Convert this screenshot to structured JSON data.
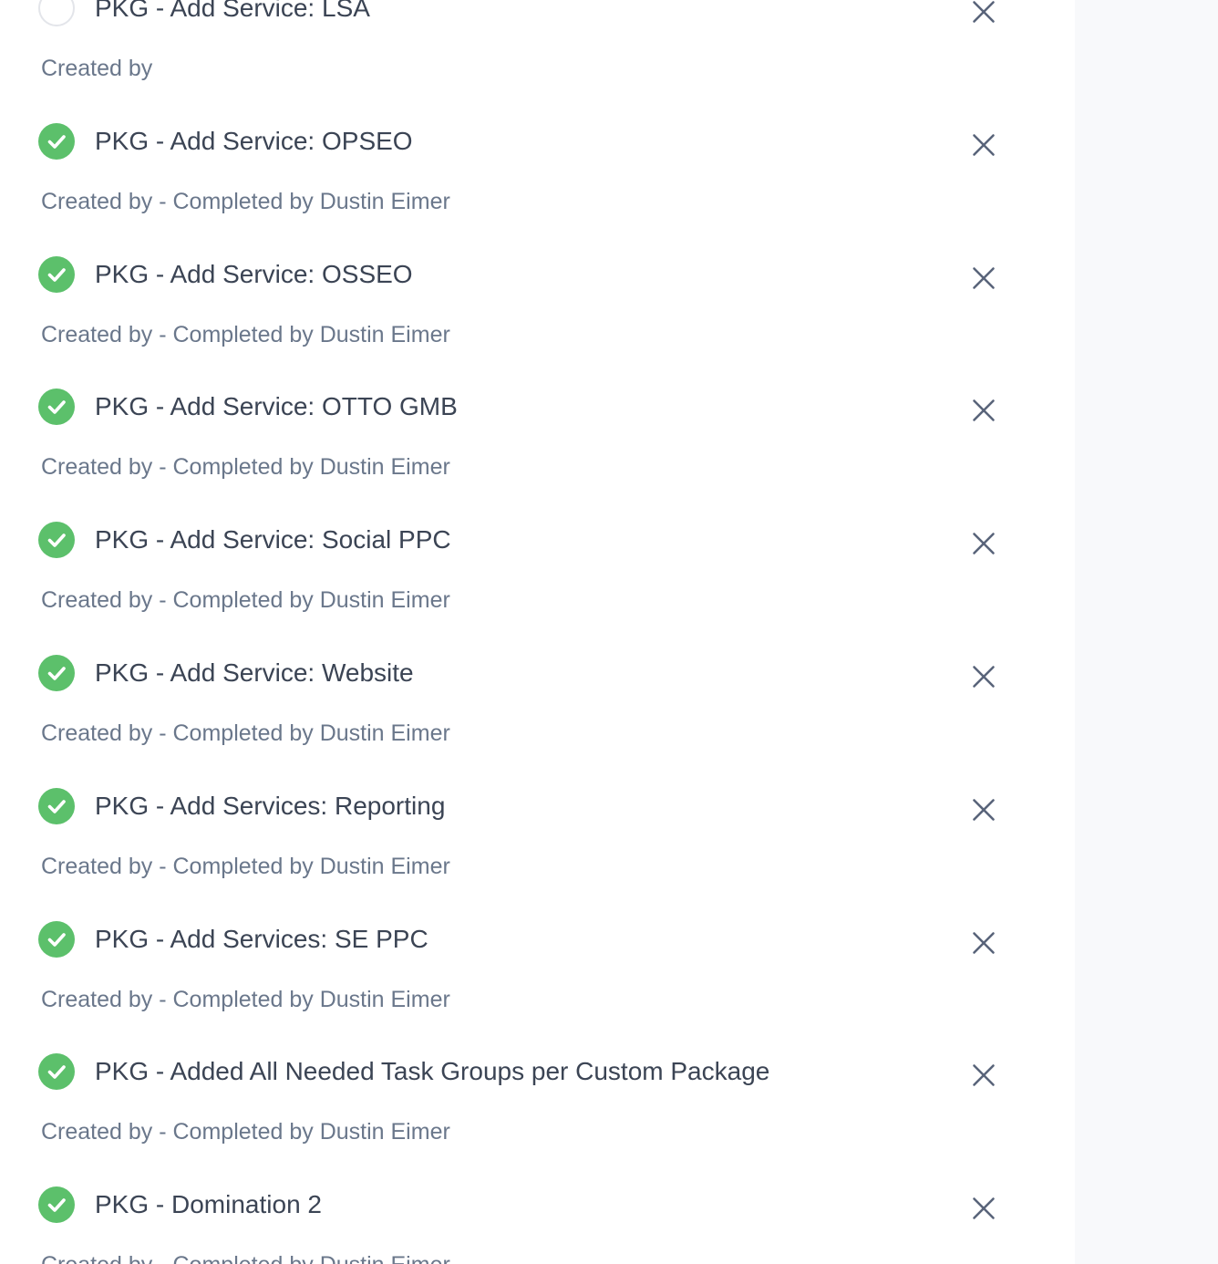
{
  "tasks": [
    {
      "title": "PKG - Add Service: LSA",
      "meta": "Created by",
      "completed": false
    },
    {
      "title": "PKG - Add Service: OPSEO",
      "meta": "Created by - Completed by Dustin Eimer",
      "completed": true
    },
    {
      "title": "PKG - Add Service: OSSEO",
      "meta": "Created by - Completed by Dustin Eimer",
      "completed": true
    },
    {
      "title": "PKG - Add Service: OTTO GMB",
      "meta": "Created by - Completed by Dustin Eimer",
      "completed": true
    },
    {
      "title": "PKG - Add Service: Social PPC",
      "meta": "Created by - Completed by Dustin Eimer",
      "completed": true
    },
    {
      "title": "PKG - Add Service: Website",
      "meta": "Created by - Completed by Dustin Eimer",
      "completed": true
    },
    {
      "title": "PKG - Add Services: Reporting",
      "meta": "Created by - Completed by Dustin Eimer",
      "completed": true
    },
    {
      "title": "PKG - Add Services: SE PPC",
      "meta": "Created by - Completed by Dustin Eimer",
      "completed": true
    },
    {
      "title": "PKG - Added All Needed Task Groups per Custom Package",
      "meta": "Created by - Completed by Dustin Eimer",
      "completed": true
    },
    {
      "title": "PKG - Domination 2",
      "meta": "Created by - Completed by Dustin Eimer",
      "completed": true
    }
  ],
  "icons": {
    "completed": "check-circle-icon",
    "incomplete": "empty-circle-icon",
    "remove": "close-icon"
  },
  "colors": {
    "check_green": "#5cc06b",
    "title_text": "#3b4454",
    "meta_text": "#6a778b",
    "close_icon": "#59647a",
    "side_panel": "#f8f9fb"
  }
}
